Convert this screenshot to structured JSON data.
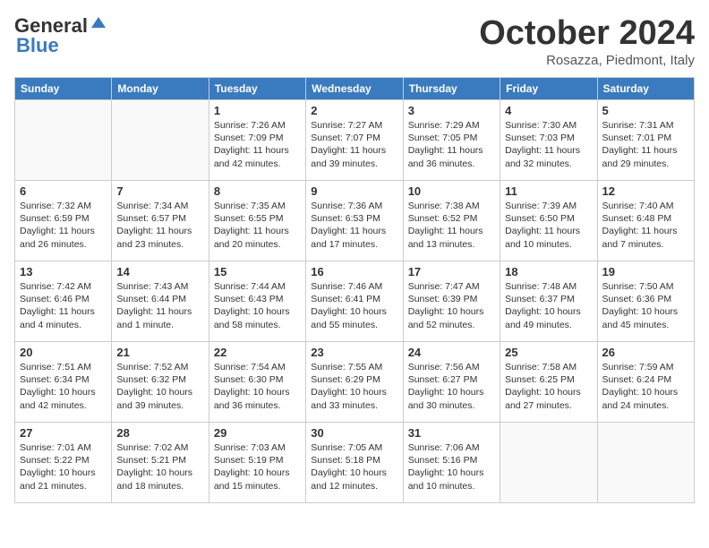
{
  "header": {
    "logo_general": "General",
    "logo_blue": "Blue",
    "month_title": "October 2024",
    "location": "Rosazza, Piedmont, Italy"
  },
  "weekdays": [
    "Sunday",
    "Monday",
    "Tuesday",
    "Wednesday",
    "Thursday",
    "Friday",
    "Saturday"
  ],
  "weeks": [
    [
      {
        "date": "",
        "sunrise": "",
        "sunset": "",
        "daylight": "",
        "empty": true
      },
      {
        "date": "",
        "sunrise": "",
        "sunset": "",
        "daylight": "",
        "empty": true
      },
      {
        "date": "1",
        "sunrise": "Sunrise: 7:26 AM",
        "sunset": "Sunset: 7:09 PM",
        "daylight": "Daylight: 11 hours and 42 minutes."
      },
      {
        "date": "2",
        "sunrise": "Sunrise: 7:27 AM",
        "sunset": "Sunset: 7:07 PM",
        "daylight": "Daylight: 11 hours and 39 minutes."
      },
      {
        "date": "3",
        "sunrise": "Sunrise: 7:29 AM",
        "sunset": "Sunset: 7:05 PM",
        "daylight": "Daylight: 11 hours and 36 minutes."
      },
      {
        "date": "4",
        "sunrise": "Sunrise: 7:30 AM",
        "sunset": "Sunset: 7:03 PM",
        "daylight": "Daylight: 11 hours and 32 minutes."
      },
      {
        "date": "5",
        "sunrise": "Sunrise: 7:31 AM",
        "sunset": "Sunset: 7:01 PM",
        "daylight": "Daylight: 11 hours and 29 minutes."
      }
    ],
    [
      {
        "date": "6",
        "sunrise": "Sunrise: 7:32 AM",
        "sunset": "Sunset: 6:59 PM",
        "daylight": "Daylight: 11 hours and 26 minutes."
      },
      {
        "date": "7",
        "sunrise": "Sunrise: 7:34 AM",
        "sunset": "Sunset: 6:57 PM",
        "daylight": "Daylight: 11 hours and 23 minutes."
      },
      {
        "date": "8",
        "sunrise": "Sunrise: 7:35 AM",
        "sunset": "Sunset: 6:55 PM",
        "daylight": "Daylight: 11 hours and 20 minutes."
      },
      {
        "date": "9",
        "sunrise": "Sunrise: 7:36 AM",
        "sunset": "Sunset: 6:53 PM",
        "daylight": "Daylight: 11 hours and 17 minutes."
      },
      {
        "date": "10",
        "sunrise": "Sunrise: 7:38 AM",
        "sunset": "Sunset: 6:52 PM",
        "daylight": "Daylight: 11 hours and 13 minutes."
      },
      {
        "date": "11",
        "sunrise": "Sunrise: 7:39 AM",
        "sunset": "Sunset: 6:50 PM",
        "daylight": "Daylight: 11 hours and 10 minutes."
      },
      {
        "date": "12",
        "sunrise": "Sunrise: 7:40 AM",
        "sunset": "Sunset: 6:48 PM",
        "daylight": "Daylight: 11 hours and 7 minutes."
      }
    ],
    [
      {
        "date": "13",
        "sunrise": "Sunrise: 7:42 AM",
        "sunset": "Sunset: 6:46 PM",
        "daylight": "Daylight: 11 hours and 4 minutes."
      },
      {
        "date": "14",
        "sunrise": "Sunrise: 7:43 AM",
        "sunset": "Sunset: 6:44 PM",
        "daylight": "Daylight: 11 hours and 1 minute."
      },
      {
        "date": "15",
        "sunrise": "Sunrise: 7:44 AM",
        "sunset": "Sunset: 6:43 PM",
        "daylight": "Daylight: 10 hours and 58 minutes."
      },
      {
        "date": "16",
        "sunrise": "Sunrise: 7:46 AM",
        "sunset": "Sunset: 6:41 PM",
        "daylight": "Daylight: 10 hours and 55 minutes."
      },
      {
        "date": "17",
        "sunrise": "Sunrise: 7:47 AM",
        "sunset": "Sunset: 6:39 PM",
        "daylight": "Daylight: 10 hours and 52 minutes."
      },
      {
        "date": "18",
        "sunrise": "Sunrise: 7:48 AM",
        "sunset": "Sunset: 6:37 PM",
        "daylight": "Daylight: 10 hours and 49 minutes."
      },
      {
        "date": "19",
        "sunrise": "Sunrise: 7:50 AM",
        "sunset": "Sunset: 6:36 PM",
        "daylight": "Daylight: 10 hours and 45 minutes."
      }
    ],
    [
      {
        "date": "20",
        "sunrise": "Sunrise: 7:51 AM",
        "sunset": "Sunset: 6:34 PM",
        "daylight": "Daylight: 10 hours and 42 minutes."
      },
      {
        "date": "21",
        "sunrise": "Sunrise: 7:52 AM",
        "sunset": "Sunset: 6:32 PM",
        "daylight": "Daylight: 10 hours and 39 minutes."
      },
      {
        "date": "22",
        "sunrise": "Sunrise: 7:54 AM",
        "sunset": "Sunset: 6:30 PM",
        "daylight": "Daylight: 10 hours and 36 minutes."
      },
      {
        "date": "23",
        "sunrise": "Sunrise: 7:55 AM",
        "sunset": "Sunset: 6:29 PM",
        "daylight": "Daylight: 10 hours and 33 minutes."
      },
      {
        "date": "24",
        "sunrise": "Sunrise: 7:56 AM",
        "sunset": "Sunset: 6:27 PM",
        "daylight": "Daylight: 10 hours and 30 minutes."
      },
      {
        "date": "25",
        "sunrise": "Sunrise: 7:58 AM",
        "sunset": "Sunset: 6:25 PM",
        "daylight": "Daylight: 10 hours and 27 minutes."
      },
      {
        "date": "26",
        "sunrise": "Sunrise: 7:59 AM",
        "sunset": "Sunset: 6:24 PM",
        "daylight": "Daylight: 10 hours and 24 minutes."
      }
    ],
    [
      {
        "date": "27",
        "sunrise": "Sunrise: 7:01 AM",
        "sunset": "Sunset: 5:22 PM",
        "daylight": "Daylight: 10 hours and 21 minutes."
      },
      {
        "date": "28",
        "sunrise": "Sunrise: 7:02 AM",
        "sunset": "Sunset: 5:21 PM",
        "daylight": "Daylight: 10 hours and 18 minutes."
      },
      {
        "date": "29",
        "sunrise": "Sunrise: 7:03 AM",
        "sunset": "Sunset: 5:19 PM",
        "daylight": "Daylight: 10 hours and 15 minutes."
      },
      {
        "date": "30",
        "sunrise": "Sunrise: 7:05 AM",
        "sunset": "Sunset: 5:18 PM",
        "daylight": "Daylight: 10 hours and 12 minutes."
      },
      {
        "date": "31",
        "sunrise": "Sunrise: 7:06 AM",
        "sunset": "Sunset: 5:16 PM",
        "daylight": "Daylight: 10 hours and 10 minutes."
      },
      {
        "date": "",
        "sunrise": "",
        "sunset": "",
        "daylight": "",
        "empty": true
      },
      {
        "date": "",
        "sunrise": "",
        "sunset": "",
        "daylight": "",
        "empty": true
      }
    ]
  ]
}
